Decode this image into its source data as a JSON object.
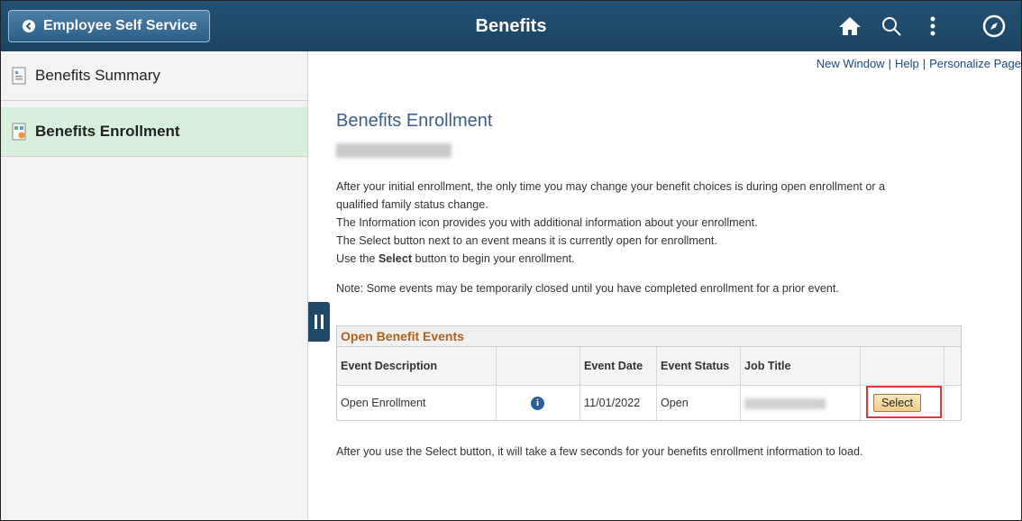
{
  "header": {
    "back_label": "Employee Self Service",
    "title": "Benefits",
    "icons": [
      "home-icon",
      "search-icon",
      "more-options-icon",
      "navbar-compass-icon"
    ],
    "bg_color": "#1f4967"
  },
  "sidebar": {
    "items": [
      {
        "label": "Benefits Summary",
        "active": false
      },
      {
        "label": "Benefits Enrollment",
        "active": true
      }
    ]
  },
  "links": {
    "new_window": "New Window",
    "help": "Help",
    "personalize": "Personalize Page"
  },
  "main": {
    "title": "Benefits Enrollment",
    "para_line1": "After your initial enrollment, the only time you may change your benefit choices is during open enrollment or a qualified family status change.",
    "para_line2": "The Information icon provides you with additional information about your enrollment.",
    "para_line3": "The Select button next to an event means it is currently open for enrollment.",
    "para_line4_pre": "Use the ",
    "para_line4_bold": "Select",
    "para_line4_post": " button to begin your enrollment.",
    "note": "Note: Some events may be temporarily closed until you have completed enrollment for a prior event.",
    "bottom": "After you use the Select button, it will take a few seconds for your benefits enrollment information to load."
  },
  "grid": {
    "title": "Open Benefit Events",
    "headers": [
      "Event Description",
      "",
      "Event Date",
      "Event Status",
      "Job Title",
      ""
    ],
    "row": {
      "description": "Open Enrollment",
      "date": "11/01/2022",
      "status": "Open",
      "select_label": "Select"
    }
  }
}
